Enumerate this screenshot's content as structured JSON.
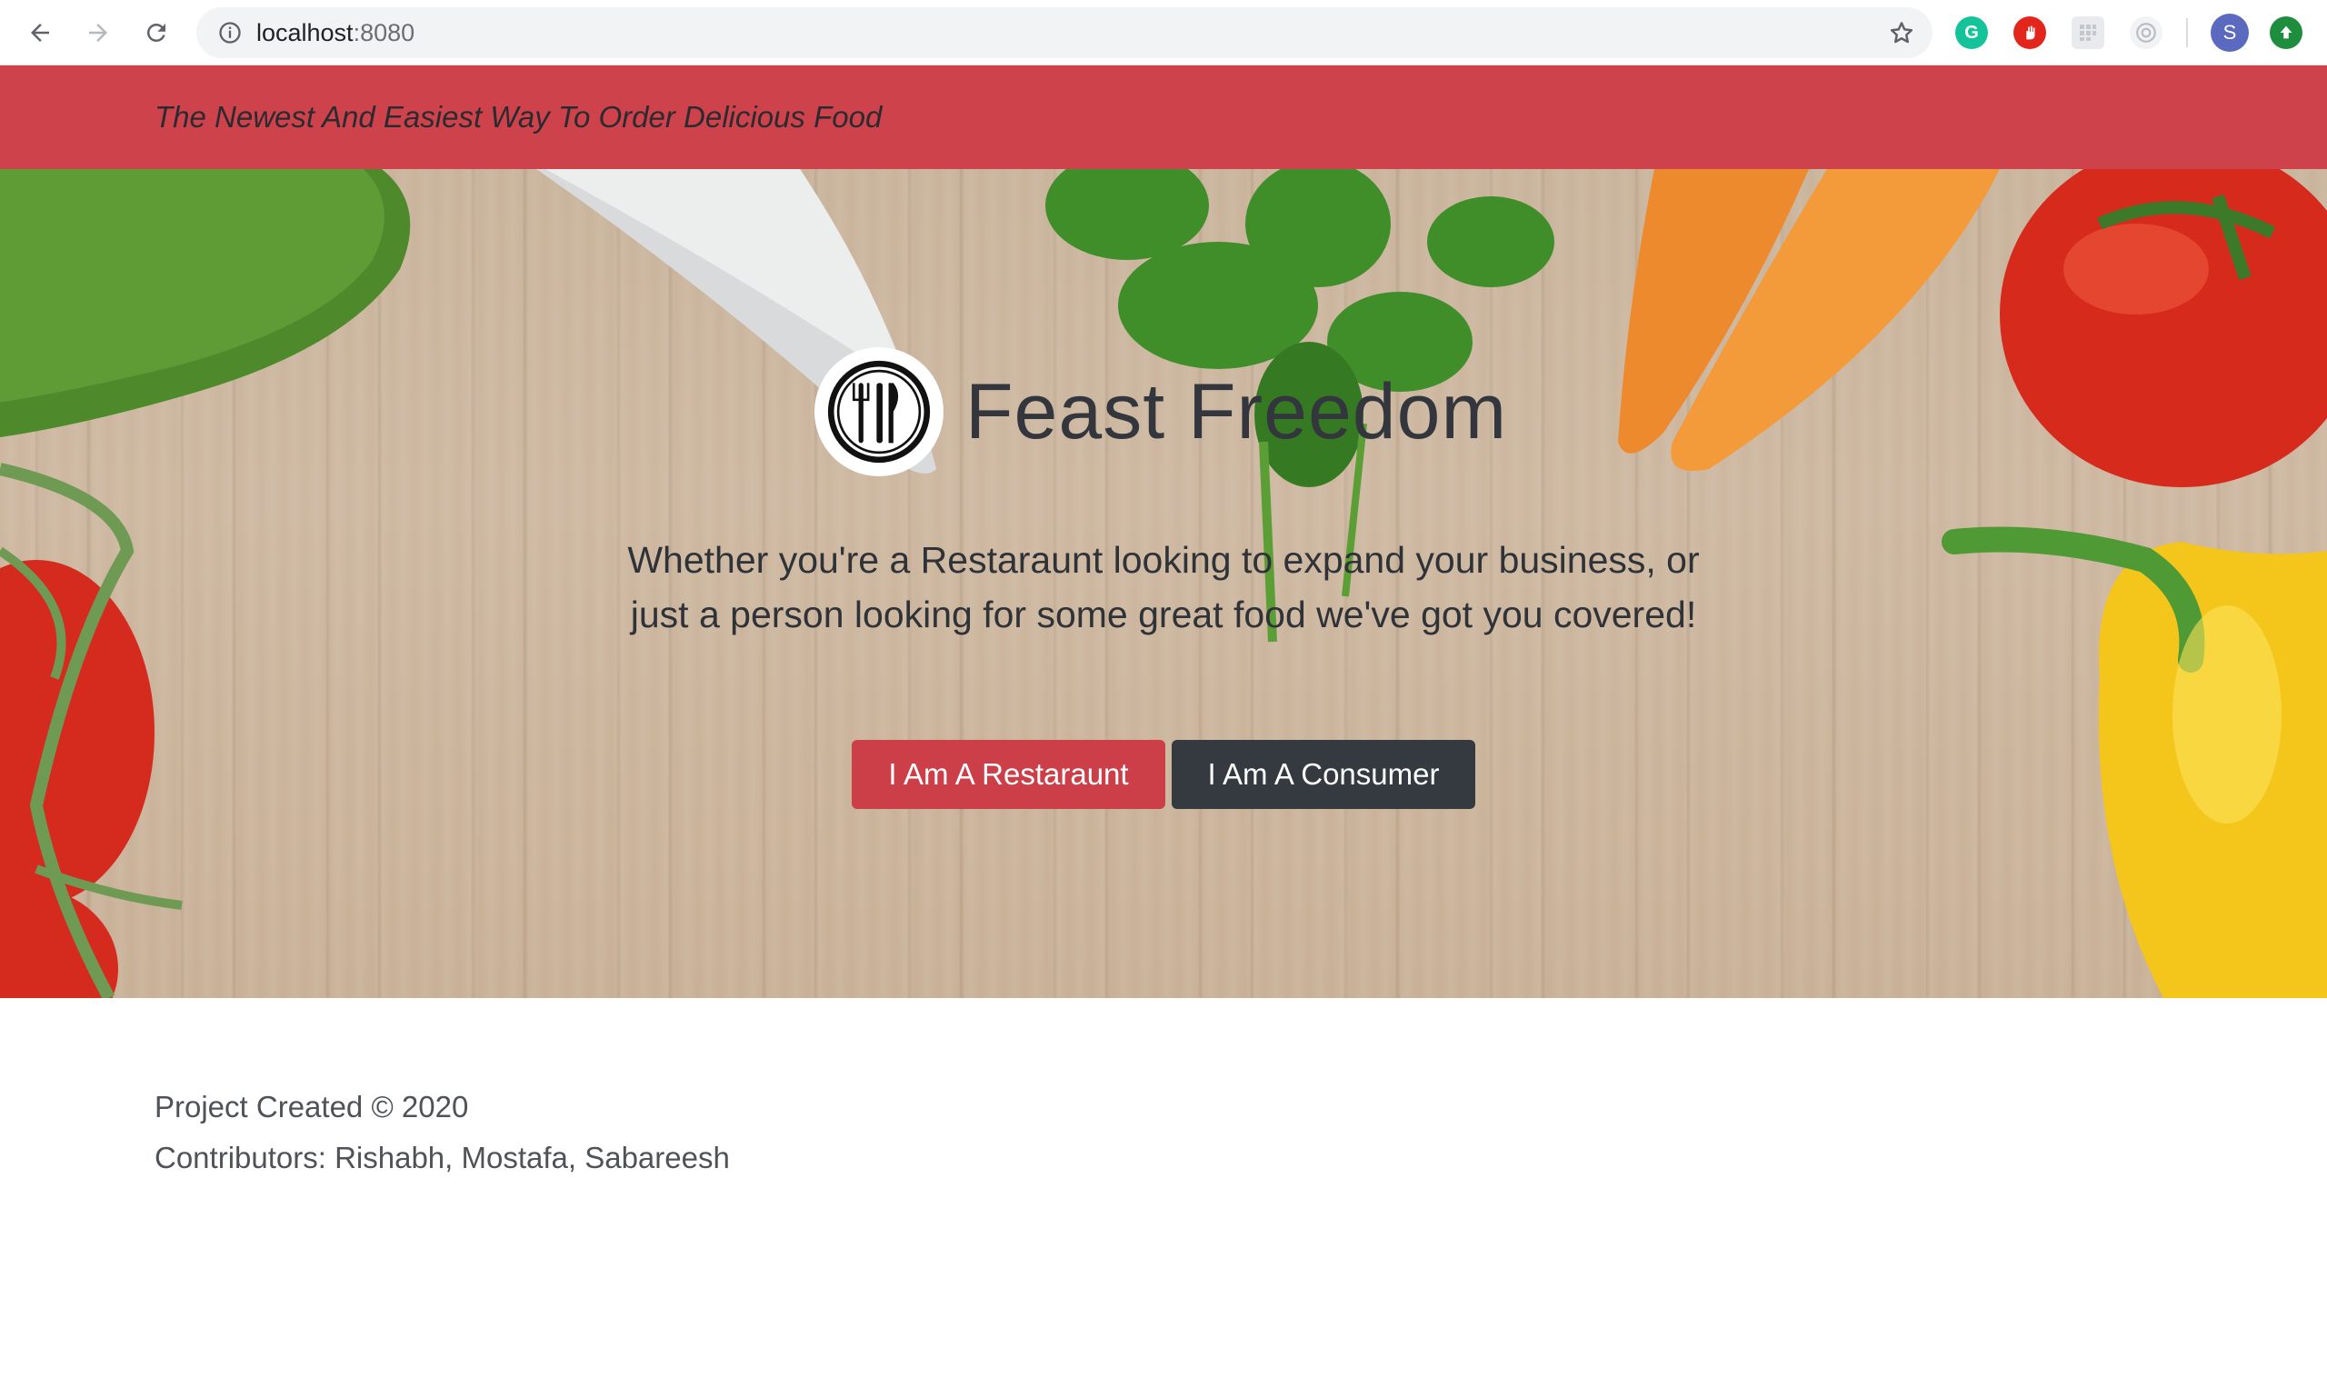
{
  "browser": {
    "url_host": "localhost",
    "url_port": ":8080",
    "profile_initial": "S",
    "icons": [
      "back-icon",
      "forward-icon",
      "reload-icon",
      "info-icon",
      "star-icon",
      "grammarly-icon",
      "adblock-icon",
      "extension-icon",
      "camera-extension-icon",
      "profile-avatar",
      "update-icon"
    ]
  },
  "banner": {
    "tagline": "The Newest And Easiest Way To Order Delicious Food",
    "color": "#ce424c"
  },
  "hero": {
    "title": "Feast Freedom",
    "description": "Whether you're a Restaraunt looking to expand your business, or just a person looking for some great food we've got you covered!",
    "buttons": {
      "restaurant": "I Am A Restaraunt",
      "consumer": "I Am A Consumer"
    },
    "colors": {
      "restaurant_btn": "#cc3f48",
      "consumer_btn": "#343a40"
    }
  },
  "footer": {
    "copyright": "Project Created © 2020",
    "contributors": "Contributors: Rishabh, Mostafa, Sabareesh"
  }
}
